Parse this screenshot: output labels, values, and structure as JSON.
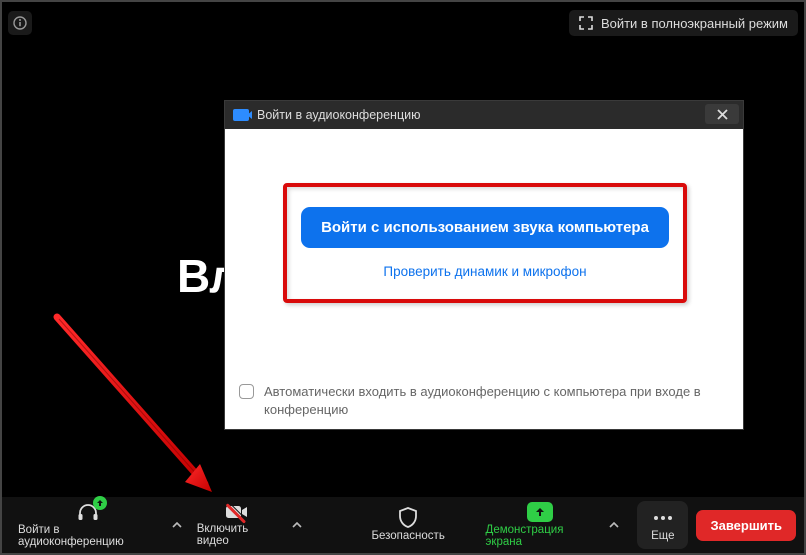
{
  "topbar": {
    "fullscreen_label": "Войти в полноэкранный режим"
  },
  "background": {
    "truncated_text": "Вл"
  },
  "dialog": {
    "title": "Войти в аудиоконференцию",
    "join_button": "Войти с использованием звука компьютера",
    "test_link": "Проверить динамик и микрофон",
    "auto_checkbox_label": "Автоматически входить в аудиоконференцию с компьютера при входе в конференцию"
  },
  "toolbar": {
    "audio_label": "Войти в аудиоконференцию",
    "video_label": "Включить видео",
    "security_label": "Безопасность",
    "share_label": "Демонстрация экрана",
    "more_label": "Еще",
    "end_label": "Завершить"
  }
}
